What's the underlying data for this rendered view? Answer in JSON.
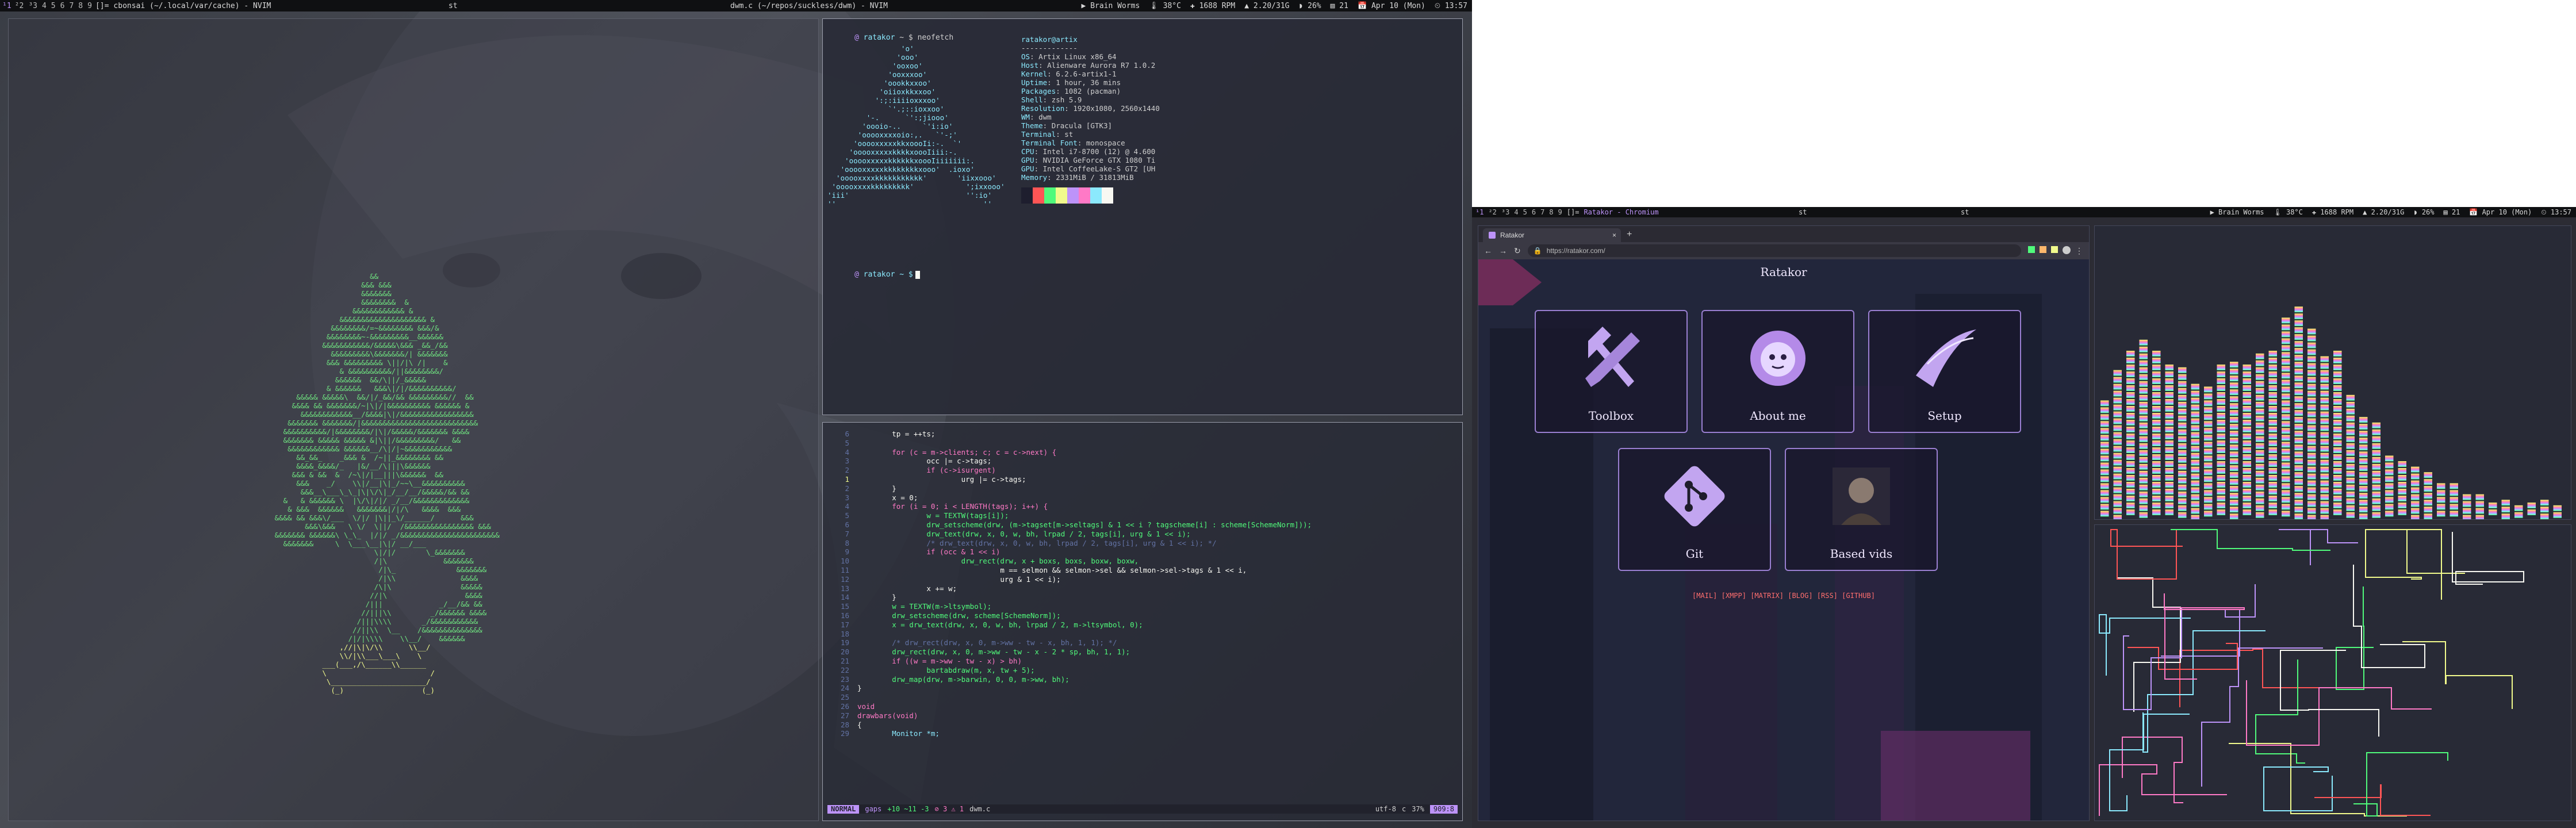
{
  "monitor_left": {
    "bar": {
      "tags": [
        "²2",
        "³3",
        "4",
        "5",
        "6",
        "7",
        "8",
        "9"
      ],
      "selected_tag": "¹1",
      "layout": "[]=",
      "window_title": "cbonsai (~/.local/var/cache) - NVIM",
      "second_title": "st",
      "center_title": "dwm.c (~/repos/suckless/dwm) - NVIM",
      "status": [
        "▶ Brain Worms",
        "🌡 38°C",
        "✚ 1688 RPM",
        "▲ 2.20/31G",
        "◗ 26%",
        "▤ 21",
        "📅 Apr 10 (Mon)",
        "⏲ 13:57"
      ]
    }
  },
  "monitor_right": {
    "bar": {
      "tags": [
        "¹1",
        "²2",
        "³3",
        "4",
        "5",
        "6",
        "7",
        "8",
        "9"
      ],
      "layout": "[]=",
      "window_title": "Ratakor - Chromium",
      "second_title": "st",
      "third_title": "st",
      "status": [
        "▶ Brain Worms",
        "🌡 38°C",
        "✚ 1688 RPM",
        "▲ 2.20/31G",
        "◗ 26%",
        "▤ 21",
        "📅 Apr 10 (Mon)",
        "⏲ 13:57"
      ]
    }
  },
  "neofetch": {
    "prompt_user": "ratakor",
    "prompt_cmd": "neofetch",
    "header": "ratakor@artix",
    "dashes": "-------------",
    "info": [
      {
        "k": "OS",
        "v": "Artix Linux x86_64"
      },
      {
        "k": "Host",
        "v": "Alienware Aurora R7 1.0.2"
      },
      {
        "k": "Kernel",
        "v": "6.2.6-artix1-1"
      },
      {
        "k": "Uptime",
        "v": "1 hour, 36 mins"
      },
      {
        "k": "Packages",
        "v": "1082 (pacman)"
      },
      {
        "k": "Shell",
        "v": "zsh 5.9"
      },
      {
        "k": "Resolution",
        "v": "1920x1080, 2560x1440"
      },
      {
        "k": "WM",
        "v": "dwm"
      },
      {
        "k": "Theme",
        "v": "Dracula [GTK3]"
      },
      {
        "k": "Terminal",
        "v": "st"
      },
      {
        "k": "Terminal Font",
        "v": "monospace"
      },
      {
        "k": "CPU",
        "v": "Intel i7-8700 (12) @ 4.600"
      },
      {
        "k": "GPU",
        "v": "NVIDIA GeForce GTX 1080 Ti"
      },
      {
        "k": "GPU",
        "v": "Intel CoffeeLake-S GT2 [UH"
      },
      {
        "k": "Memory",
        "v": "2331MiB / 31813MiB"
      }
    ],
    "palette": [
      "#1e1e2e",
      "#ff5555",
      "#50fa7b",
      "#f1fa8c",
      "#bd93f9",
      "#ff79c6",
      "#8be9fd",
      "#f8f8f2"
    ],
    "logo": [
      "                 'o'",
      "                'ooo'",
      "               'ooxoo'",
      "              'ooxxxoo'",
      "             'oookkxxoo'",
      "            'oiioxkkxxoo'",
      "           ':;:iiiioxxxoo'",
      "              `'.;::ioxxoo'",
      "         '-.      `':;jiooo'",
      "        'oooio-..     `'i:io'",
      "       'ooooxxxxoio:,.   `'-;'",
      "      'ooooxxxxxkkxoooIi:-.  `'",
      "     'ooooxxxxxkkkkxoooIiii:-.",
      "    'ooooxxxxxkkkkkkxoooIiiiiiii:.",
      "   'ooooxxxxxkkkkkkkkxooo'  .ioxo'",
      "  'ooooxxxxkkkkkkkkkkk'       'iixxooo'",
      " 'ooooxxxxkkkkkkkkk'            ';ixxooo'",
      "'iii'                           '':io'",
      "''                                  ''"
    ],
    "prompt2": "ratakor ~ $"
  },
  "editor": {
    "lines": [
      {
        "n": "6",
        "t": "        tp = ++ts;"
      },
      {
        "n": "5",
        "t": ""
      },
      {
        "n": "4",
        "t": "        for (c = m->clients; c; c = c->next) {"
      },
      {
        "n": "3",
        "t": "                occ |= c->tags;"
      },
      {
        "n": "2",
        "t": "                if (c->isurgent)"
      },
      {
        "n": "1",
        "t": "                        urg |= c->tags;"
      },
      {
        "n": "2",
        "t": "        }"
      },
      {
        "n": "3",
        "t": "        x = 0;"
      },
      {
        "n": "4",
        "t": "        for (i = 0; i < LENGTH(tags); i++) {"
      },
      {
        "n": "5",
        "t": "                w = TEXTW(tags[i]);"
      },
      {
        "n": "6",
        "t": "                drw_setscheme(drw, (m->tagset[m->seltags] & 1 << i ? tagscheme[i] : scheme[SchemeNorm]));"
      },
      {
        "n": "7",
        "t": "                drw_text(drw, x, 0, w, bh, lrpad / 2, tags[i], urg & 1 << i);"
      },
      {
        "n": "8",
        "t": "                /* drw_text(drw, x, 0, w, bh, lrpad / 2, tags[i], urg & 1 << i); */"
      },
      {
        "n": "9",
        "t": "                if (occ & 1 << i)"
      },
      {
        "n": "10",
        "t": "                        drw_rect(drw, x + boxs, boxs, boxw, boxw,"
      },
      {
        "n": "11",
        "t": "                                 m == selmon && selmon->sel && selmon->sel->tags & 1 << i,"
      },
      {
        "n": "12",
        "t": "                                 urg & 1 << i);"
      },
      {
        "n": "13",
        "t": "                x += w;"
      },
      {
        "n": "14",
        "t": "        }"
      },
      {
        "n": "15",
        "t": "        w = TEXTW(m->ltsymbol);"
      },
      {
        "n": "16",
        "t": "        drw_setscheme(drw, scheme[SchemeNorm]);"
      },
      {
        "n": "17",
        "t": "        x = drw_text(drw, x, 0, w, bh, lrpad / 2, m->ltsymbol, 0);"
      },
      {
        "n": "18",
        "t": ""
      },
      {
        "n": "19",
        "t": "        /* drw_rect(drw, x, 0, m->ww - tw - x, bh, 1, 1); */"
      },
      {
        "n": "20",
        "t": "        drw_rect(drw, x, 0, m->ww - tw - x - 2 * sp, bh, 1, 1);"
      },
      {
        "n": "21",
        "t": "        if ((w = m->ww - tw - x) > bh)"
      },
      {
        "n": "22",
        "t": "                bartabdraw(m, x, tw + 5);"
      },
      {
        "n": "23",
        "t": "        drw_map(drw, m->barwin, 0, 0, m->ww, bh);"
      },
      {
        "n": "24",
        "t": "}"
      },
      {
        "n": "25",
        "t": ""
      },
      {
        "n": "26",
        "t": "void"
      },
      {
        "n": "27",
        "t": "drawbars(void)"
      },
      {
        "n": "28",
        "t": "{"
      },
      {
        "n": "29",
        "t": "        Monitor *m;"
      }
    ],
    "status": {
      "mode": "NORMAL",
      "branch": "gaps",
      "diff": "+10 ~11 -3",
      "diag": "⊘ 3 ⚠ 1",
      "file": "dwm.c",
      "encoding": "utf-8",
      "ft": "c",
      "pct": "37%",
      "pos": "909:8"
    }
  },
  "bonsai": {
    "lines": [
      "                         &&",
      "                       &&& &&&",
      "                       &&&&&&&",
      "                       &&&&&&&&  &",
      "                     &&&&&&&&&&&& &",
      "                  &&&&&&&&&&&&&&&&&&&& &",
      "                &&&&&&&&/=~&&&&&&&& &&&/&",
      "               &&&&&&&&~-&&&&&&&&&__&&&&&&",
      "              &&&&&&&&&&&/&&&&&\\&&& _&&_/&&",
      "                &&&&&&&&&\\&&&&&&&/| &&&&&&&",
      "               &&& &&&&&&&&& \\||/|\\ /|    &",
      "                  & &&&&&&&&&&/||&&&&&&&&/",
      "                 &&&&&&  &&/\\||/_&&&&&",
      "               & &&&&&&   &&&\\|/|/&&&&&&&&&&/",
      "        &&&&& &&&&&\\  &&/|/_&&/&& &&&&&&&&&//  &&",
      "       &&&& && &&&&&&&/~|\\|/|&&&&&&&&&& &&&&&& &",
      "         &&&&&&&&&&&&__/&&&&|\\|/&&&&&&&&&&&&&&&&&",
      "      &&&&&&& &&&&&&&/|&&&&&&&&&&&&&&&&&&&&&&&&&&&",
      "     &&&&&&&&&&/|&&&&&&&&/|\\|/&&&&&/&&&&&&& &&&&",
      "     &&&&&&& &&&&& &&&&& &|\\||/&&&&&&&&&/   &&",
      "      &&&&&&&&&&&& &&&&&&__/\\|/|~&&&&&&&&&&&",
      "        &&_&&_    _&&& &  /~||_&&&&&&&& &&",
      "        &&&&_&&&&/_   |&/__/\\|||\\&&&&&&",
      "       &&& & &&  &  /~\\|/|__|||\\&&&&&&  &&",
      "        &&&    _/    \\\\|/__|\\|_/~~\\__&&&&&&&&&&",
      "         &&&__\\___\\_\\_|\\|\\/\\|_/__/__/&&&&&/&& &&",
      "     &   & &&&&&& \\  |\\/\\|/|/ _/__/&&&&&&&&&&&&&",
      "      & &&&  &&&&&&   &&&&&&&|/|/\\   &&&&  &&&",
      "   &&&& && &&&\\/___  \\/|/ |\\||_\\/______/      &&&",
      "          &&&\\&&&   \\ \\/  \\||/  /&&&&&&&&&&&&&&&& &&&",
      "   &&&&&&& &&&&&&\\ \\_\\_  |/|/ _/&&&&&&&&&&&&&&&&&&&&&&&",
      "     &&&&&&&     \\  \\___\\__|\\|/ __/___",
      "                          \\|/|/       \\_&&&&&&&",
      "                          /|\\             &&&&&&&",
      "                           /|\\_              &&&&&&&",
      "                           /|\\\\               &&&&",
      "                          /\\|\\                &&&&&",
      "                         //|\\                  &&&&",
      "                        /|||             _/__/&& &&",
      "                       //|||\\\\         _/&&&&&& &&&&",
      "                      /|||\\\\\\\\       _/&&&&&&&&&&&",
      "                     //||\\\\  \\__    /&&&&&&&&&&&&&&",
      "                    /|/|\\\\\\\\    \\\\__/    &&&&&&",
      "                  ,//|\\|\\/\\\\      \\\\__/",
      "                  \\\\/|\\\\___\\___\\    \\",
      "              ___(___,/\\______\\\\______",
      "              \\                        /",
      "               \\______________________/",
      "                (_)                  (_)"
    ]
  },
  "browser": {
    "tab_title": "Ratakor",
    "new_tab": "+",
    "url": "https://ratakor.com/",
    "page_title": "Ratakor",
    "cards": [
      {
        "label": "Toolbox",
        "icon": "hammer-wrench-icon"
      },
      {
        "label": "About me",
        "icon": "avatar-icon"
      },
      {
        "label": "Setup",
        "icon": "swoosh-icon"
      },
      {
        "label": "Git",
        "icon": "git-icon"
      },
      {
        "label": "Based vids",
        "icon": "portrait-icon"
      }
    ],
    "footer_links": "[MAIL] [XMPP] [MATRIX] [BLOG] [RSS] [GITHUB]"
  },
  "visualizer": {
    "values": [
      0.42,
      0.53,
      0.6,
      0.64,
      0.6,
      0.55,
      0.54,
      0.48,
      0.47,
      0.55,
      0.56,
      0.55,
      0.59,
      0.6,
      0.72,
      0.76,
      0.68,
      0.58,
      0.6,
      0.44,
      0.36,
      0.34,
      0.22,
      0.2,
      0.18,
      0.16,
      0.12,
      0.12,
      0.08,
      0.08,
      0.05,
      0.06,
      0.04,
      0.05,
      0.06,
      0.04
    ],
    "colors": [
      "#f1fa8c",
      "#ffb86c",
      "#ff79c6",
      "#bd93f9",
      "#8be9fd",
      "#50fa7b"
    ]
  },
  "pipes": {
    "colors": [
      "#ff5555",
      "#50fa7b",
      "#f1fa8c",
      "#bd93f9",
      "#ff79c6",
      "#8be9fd",
      "#f8f8f2"
    ]
  }
}
